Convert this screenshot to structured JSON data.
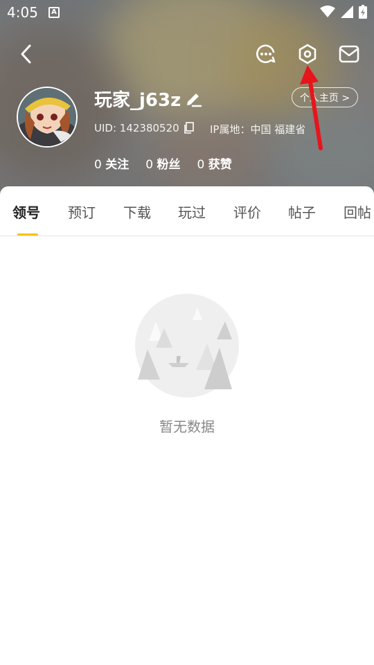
{
  "status_bar": {
    "time": "4:05",
    "notification_badge": "A"
  },
  "icons": {
    "back": "back-arrow-icon",
    "chat": "chat-bubble-icon",
    "settings": "settings-hexagon-icon",
    "mail": "mail-icon",
    "edit": "pencil-icon",
    "copy": "copy-icon",
    "empty": "empty-landscape-icon"
  },
  "profile": {
    "username": "玩家_j63z",
    "homepage_label": "个人主页 >",
    "uid_label": "UID: 142380520",
    "ip_label": "IP属地：中国 福建省"
  },
  "stats": [
    {
      "count": "0",
      "label": "关注"
    },
    {
      "count": "0",
      "label": "粉丝"
    },
    {
      "count": "0",
      "label": "获赞"
    }
  ],
  "tabs": [
    "领号",
    "预订",
    "下载",
    "玩过",
    "评价",
    "帖子",
    "回帖"
  ],
  "empty_state": {
    "text": "暂无数据"
  },
  "colors": {
    "accent": "#f6c400",
    "annotation": "#e8141c"
  }
}
